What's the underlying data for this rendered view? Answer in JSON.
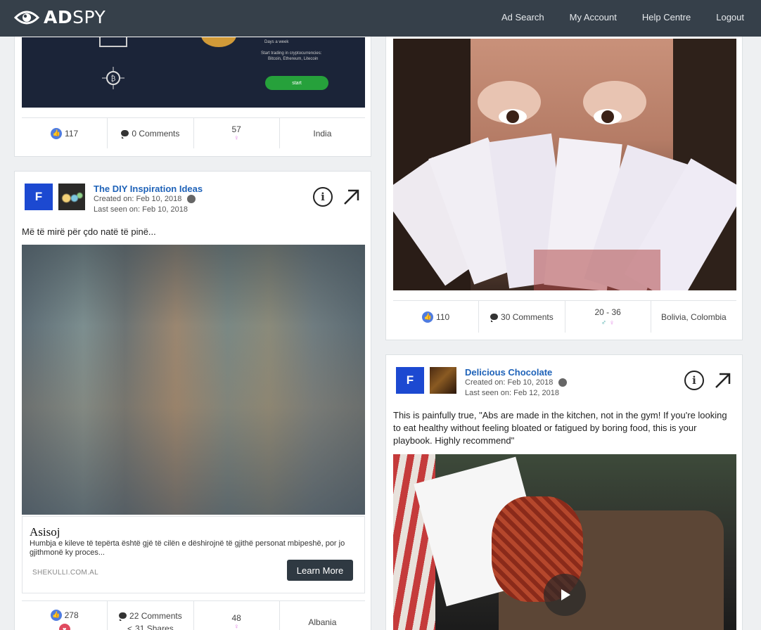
{
  "nav": {
    "logo_bold": "AD",
    "logo_light": "SPY",
    "links": [
      "Ad Search",
      "My Account",
      "Help Centre",
      "Logout"
    ]
  },
  "card1": {
    "promo_text_line1": "Days a week",
    "promo_text_line2": "Start trading in cryptocurrencies:",
    "promo_text_line3": "Bitcoin, Ethereum, Litecoin",
    "promo_button": "start",
    "likes": "117",
    "comments": "0 Comments",
    "age": "57",
    "country": "India"
  },
  "card2": {
    "badge": "F",
    "page_name": "The DIY Inspiration Ideas",
    "created": "Created on: Feb 10, 2018",
    "last_seen": "Last seen on: Feb 10, 2018",
    "text": "Më të mirë për çdo natë të pinë...",
    "cta_title": "Asisoj",
    "cta_desc": "Humbja e kileve të tepërta është gjë të cilën e dëshirojnë të gjithë personat mbipeshë, por jo gjithmonë ky proces...",
    "cta_domain": "SHEKULLI.COM.AL",
    "cta_button": "Learn More",
    "likes": "278",
    "comments": "22 Comments",
    "shares": "31 Shares",
    "age": "48",
    "country": "Albania"
  },
  "card3": {
    "likes": "110",
    "comments": "30 Comments",
    "age": "20 - 36",
    "country": "Bolivia, Colombia"
  },
  "card4": {
    "badge": "F",
    "page_name": "Delicious Chocolate",
    "created": "Created on: Feb 10, 2018",
    "last_seen": "Last seen on: Feb 12, 2018",
    "text": "This is painfully true, \"Abs are made in the kitchen, not in the gym! If you're looking to eat healthy without feeling bloated or fatigued by boring food, this is your playbook. Highly recommend\""
  },
  "colors": {
    "navbar": "#36404a",
    "link": "#1e62b8",
    "badge": "#1c49d1",
    "like": "#4f7ce0",
    "female": "#e07ce4",
    "male": "#2a9d9a"
  }
}
